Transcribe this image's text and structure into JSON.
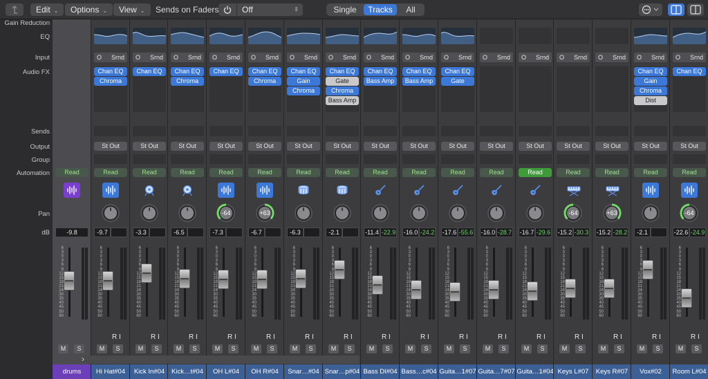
{
  "toolbar": {
    "edit_label": "Edit",
    "options_label": "Options",
    "view_label": "View",
    "sends_on_faders_label": "Sends on Faders:",
    "sends_value": "Off",
    "filter_single": "Single",
    "filter_tracks": "Tracks",
    "filter_all": "All",
    "active_filter": "Tracks"
  },
  "row_labels": {
    "gain_reduction": "Gain Reduction",
    "eq": "EQ",
    "input": "Input",
    "audio_fx": "Audio FX",
    "sends": "Sends",
    "output": "Output",
    "group": "Group",
    "automation": "Automation",
    "pan": "Pan",
    "db": "dB"
  },
  "colors": {
    "accent_blue": "#3b78d8",
    "automation_green": "#3f9b3a",
    "track_name_blue": "#3c5f95",
    "summing_purple": "#6a3fb8"
  },
  "strips": [
    {
      "name": "drums",
      "type": "summing",
      "eq": false,
      "input": null,
      "fx": [],
      "output": null,
      "automation": "Read",
      "automation_active": false,
      "icon": "waveform-icon",
      "icon_bg": "#7a3fd0",
      "pan": null,
      "volume": "-9.8",
      "peak": null,
      "fader_level": 0.62
    },
    {
      "name": "Hi Hat#04",
      "eq": true,
      "input": {
        "o": "O",
        "srnd": "Srnd"
      },
      "fx": [
        {
          "label": "Chan EQ"
        },
        {
          "label": "Chroma"
        }
      ],
      "output": "St Out",
      "automation": "Read",
      "automation_active": false,
      "icon": "waveform-icon",
      "icon_bg": "#3b78d8",
      "pan": null,
      "volume": "-9.7",
      "peak": "",
      "fader_level": 0.62
    },
    {
      "name": "Kick In#04",
      "eq": true,
      "input": {
        "o": "O",
        "srnd": "Srnd"
      },
      "fx": [
        {
          "label": "Chan EQ"
        }
      ],
      "output": "St Out",
      "automation": "Read",
      "automation_active": false,
      "icon": "drum-kick-icon",
      "icon_bg": null,
      "pan": null,
      "volume": "-3.3",
      "peak": "",
      "fader_level": 0.74
    },
    {
      "name": "Kick…t#04",
      "eq": true,
      "input": {
        "o": "O",
        "srnd": "Srnd"
      },
      "fx": [
        {
          "label": "Chan EQ"
        },
        {
          "label": "Chroma"
        }
      ],
      "output": "St Out",
      "automation": "Read",
      "automation_active": false,
      "icon": "drum-kick-icon",
      "icon_bg": null,
      "pan": null,
      "volume": "-6.5",
      "peak": "",
      "fader_level": 0.66
    },
    {
      "name": "OH L#04",
      "eq": true,
      "input": {
        "o": "O",
        "srnd": "Srnd"
      },
      "fx": [
        {
          "label": "Chan EQ"
        }
      ],
      "output": "St Out",
      "automation": "Read",
      "automation_active": false,
      "icon": "waveform-icon",
      "icon_bg": "#3b78d8",
      "pan": "-64",
      "volume": "-7.3",
      "peak": "",
      "fader_level": 0.64
    },
    {
      "name": "OH R#04",
      "eq": true,
      "input": {
        "o": "O",
        "srnd": "Srnd"
      },
      "fx": [
        {
          "label": "Chan EQ"
        },
        {
          "label": "Chroma"
        }
      ],
      "output": "St Out",
      "automation": "Read",
      "automation_active": false,
      "icon": "waveform-icon",
      "icon_bg": "#3b78d8",
      "pan": "+63",
      "volume": "-6.7",
      "peak": "",
      "fader_level": 0.65
    },
    {
      "name": "Snar…#04",
      "eq": true,
      "input": {
        "o": "O",
        "srnd": "Srnd"
      },
      "fx": [
        {
          "label": "Chan EQ"
        },
        {
          "label": "Gain"
        },
        {
          "label": "Chroma"
        }
      ],
      "output": "St Out",
      "automation": "Read",
      "automation_active": false,
      "icon": "snare-drum-icon",
      "icon_bg": null,
      "pan": null,
      "volume": "-6.3",
      "peak": "",
      "fader_level": 0.66
    },
    {
      "name": "Snar…p#04",
      "eq": true,
      "input": {
        "o": "O",
        "srnd": "Srnd"
      },
      "fx": [
        {
          "label": "Chan EQ"
        },
        {
          "label": "Gate",
          "bypassed": true
        },
        {
          "label": "Chroma"
        },
        {
          "label": "Bass Amp",
          "bypassed": true
        }
      ],
      "output": "St Out",
      "automation": "Read",
      "automation_active": false,
      "icon": "snare-drum-icon",
      "icon_bg": null,
      "pan": null,
      "volume": "-2.1",
      "peak": "",
      "fader_level": 0.8
    },
    {
      "name": "Bass DI#04",
      "eq": true,
      "input": {
        "o": "O",
        "srnd": "Srnd"
      },
      "fx": [
        {
          "label": "Chan EQ"
        },
        {
          "label": "Bass Amp"
        }
      ],
      "output": "St Out",
      "automation": "Read",
      "automation_active": false,
      "icon": "guitar-icon",
      "icon_bg": null,
      "pan": null,
      "volume": "-11.4",
      "peak": "-22.9",
      "fader_level": 0.56
    },
    {
      "name": "Bass…c#04",
      "eq": true,
      "input": {
        "o": "O",
        "srnd": "Srnd"
      },
      "fx": [
        {
          "label": "Chan EQ"
        },
        {
          "label": "Bass Amp"
        }
      ],
      "output": "St Out",
      "automation": "Read",
      "automation_active": false,
      "icon": "guitar-icon",
      "icon_bg": null,
      "pan": null,
      "volume": "-16.0",
      "peak": "-24.2",
      "fader_level": 0.48
    },
    {
      "name": "Guita…1#07",
      "eq": true,
      "input": {
        "o": "O",
        "srnd": "Srnd"
      },
      "fx": [
        {
          "label": "Chan EQ"
        },
        {
          "label": "Gate"
        }
      ],
      "output": "St Out",
      "automation": "Read",
      "automation_active": false,
      "icon": "guitar-icon",
      "icon_bg": null,
      "pan": null,
      "volume": "-17.6",
      "peak": "-55.6",
      "fader_level": 0.44
    },
    {
      "name": "Guita…7#07",
      "eq": false,
      "input": {
        "o": "O",
        "srnd": "Srnd"
      },
      "fx": [],
      "output": "St Out",
      "automation": "Read",
      "automation_active": false,
      "icon": "guitar-icon",
      "icon_bg": null,
      "pan": null,
      "volume": "-16.0",
      "peak": "-28.7",
      "fader_level": 0.48
    },
    {
      "name": "Guita…1#04",
      "eq": false,
      "input": {
        "o": "O",
        "srnd": "Srnd"
      },
      "fx": [],
      "output": "St Out",
      "automation": "Read",
      "automation_active": true,
      "icon": "guitar-icon",
      "icon_bg": null,
      "pan": null,
      "volume": "-16.7",
      "peak": "-29.6",
      "fader_level": 0.46
    },
    {
      "name": "Keys L#07",
      "eq": false,
      "input": {
        "o": "O",
        "srnd": "Srnd"
      },
      "fx": [],
      "output": "St Out",
      "automation": "Read",
      "automation_active": false,
      "icon": "keyboard-icon",
      "icon_bg": null,
      "pan": "-64",
      "volume": "-15.2",
      "peak": "-30.3",
      "fader_level": 0.5
    },
    {
      "name": "Keys R#07",
      "eq": false,
      "input": {
        "o": "O",
        "srnd": "Srnd"
      },
      "fx": [],
      "output": "St Out",
      "automation": "Read",
      "automation_active": false,
      "icon": "keyboard-icon",
      "icon_bg": null,
      "pan": "+63",
      "volume": "-15.2",
      "peak": "-28.2",
      "fader_level": 0.5
    },
    {
      "name": "Vox#02",
      "eq": true,
      "input": {
        "o": "O",
        "srnd": "Srnd"
      },
      "fx": [
        {
          "label": "Chan EQ"
        },
        {
          "label": "Gain"
        },
        {
          "label": "Chroma"
        },
        {
          "label": "Dist",
          "bypassed": true
        }
      ],
      "output": "St Out",
      "automation": "Read",
      "automation_active": false,
      "icon": "waveform-icon",
      "icon_bg": "#3b78d8",
      "pan": null,
      "volume": "-2.1",
      "peak": "",
      "fader_level": 0.8
    },
    {
      "name": "Room L#04",
      "eq": true,
      "input": {
        "o": "O",
        "srnd": "Srnd"
      },
      "fx": [
        {
          "label": "Chan EQ"
        }
      ],
      "output": "St Out",
      "automation": "Read",
      "automation_active": false,
      "icon": "waveform-icon",
      "icon_bg": "#3b78d8",
      "pan": "-64",
      "volume": "-22.6",
      "peak": "-24.9",
      "fader_level": 0.34
    }
  ],
  "strip_controls": {
    "read_label": "R",
    "input_label": "I",
    "mute_label": "M",
    "solo_label": "S"
  },
  "fader_scale": [
    "6",
    "3",
    "0",
    "3",
    "6",
    "9",
    "12",
    "15",
    "18",
    "21",
    "24",
    "30",
    "35",
    "40",
    "45",
    "50",
    "60"
  ]
}
